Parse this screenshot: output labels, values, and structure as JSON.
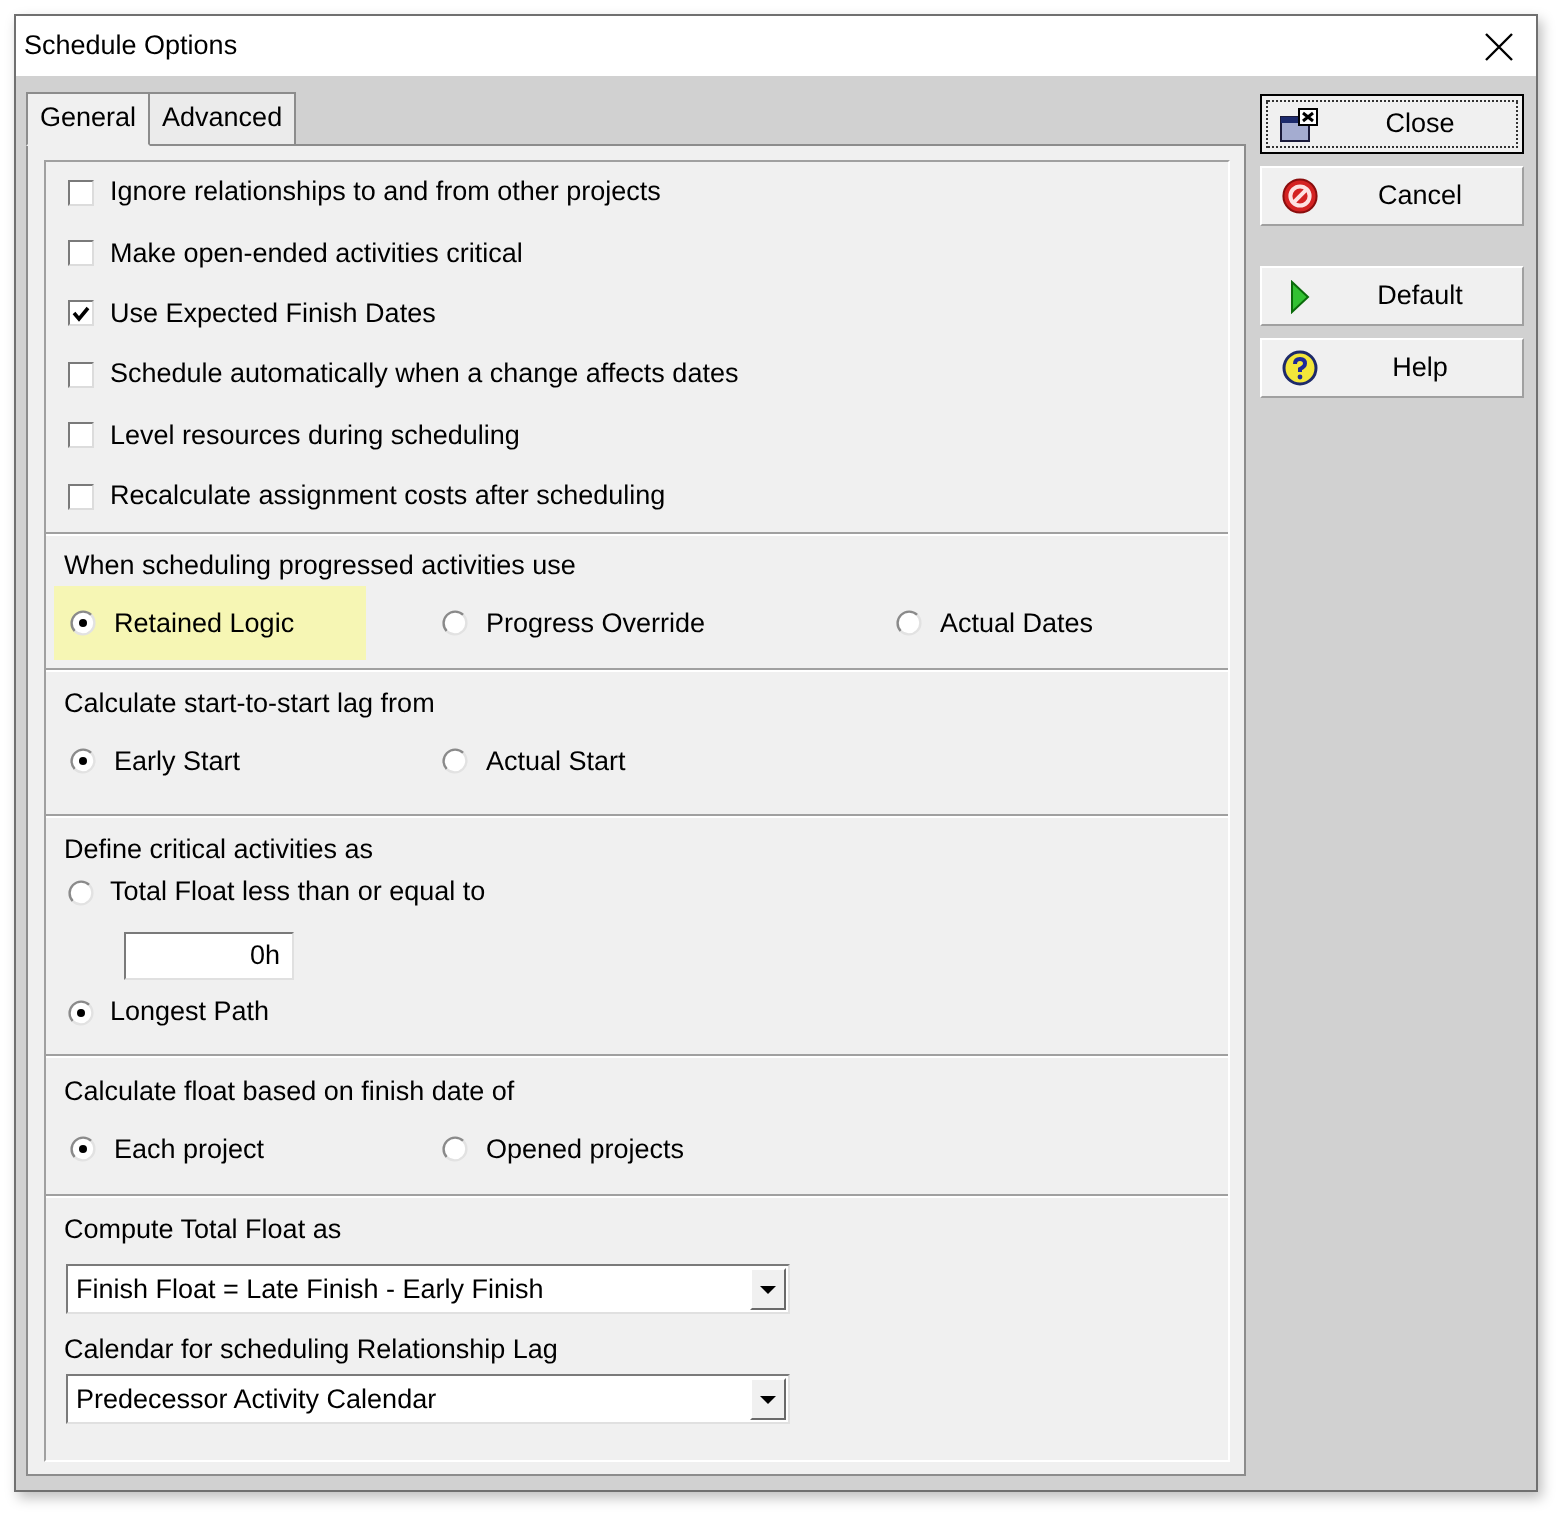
{
  "window": {
    "title": "Schedule Options"
  },
  "tabs": [
    {
      "label": "General",
      "selected": true
    },
    {
      "label": "Advanced",
      "selected": false
    }
  ],
  "sections": [
    {
      "kind": "checkboxes",
      "items": [
        {
          "label": "Ignore relationships to and from other projects",
          "checked": false
        },
        {
          "label": "Make open-ended activities critical",
          "checked": false
        },
        {
          "label": "Use Expected Finish Dates",
          "checked": true
        },
        {
          "label": "Schedule automatically when a change affects dates",
          "checked": false
        },
        {
          "label": "Level resources during scheduling",
          "checked": false
        },
        {
          "label": "Recalculate assignment costs after scheduling",
          "checked": false
        }
      ]
    },
    {
      "kind": "radios",
      "title": "When scheduling progressed activities use",
      "options": [
        {
          "label": "Retained Logic",
          "selected": true,
          "highlighted": true
        },
        {
          "label": "Progress Override",
          "selected": false,
          "highlighted": false
        },
        {
          "label": "Actual Dates",
          "selected": false,
          "highlighted": false
        }
      ]
    },
    {
      "kind": "radios",
      "title": "Calculate start-to-start lag from",
      "options": [
        {
          "label": "Early Start",
          "selected": true,
          "highlighted": false
        },
        {
          "label": "Actual Start",
          "selected": false,
          "highlighted": false
        }
      ]
    },
    {
      "kind": "threshold",
      "title": "Define critical activities as",
      "options": [
        {
          "label": "Total Float less than or equal to",
          "selected": false
        },
        {
          "label": "Longest Path",
          "selected": true
        }
      ],
      "field": {
        "value": "0h"
      }
    },
    {
      "kind": "radios",
      "title": "Calculate float based on finish date of",
      "options": [
        {
          "label": "Each project",
          "selected": true,
          "highlighted": false
        },
        {
          "label": "Opened projects",
          "selected": false,
          "highlighted": false
        }
      ]
    },
    {
      "kind": "dropdowns",
      "items": [
        {
          "label": "Compute Total Float as",
          "value": "Finish Float = Late Finish - Early Finish"
        },
        {
          "label": "Calendar for scheduling Relationship Lag",
          "value": "Predecessor Activity Calendar"
        }
      ]
    }
  ],
  "button_groups": [
    {
      "buttons": [
        {
          "label": "Close",
          "focused": true
        },
        {
          "label": "Cancel",
          "focused": false
        }
      ]
    },
    {
      "buttons": [
        {
          "label": "Default",
          "focused": false
        },
        {
          "label": "Help",
          "focused": false
        }
      ]
    }
  ]
}
